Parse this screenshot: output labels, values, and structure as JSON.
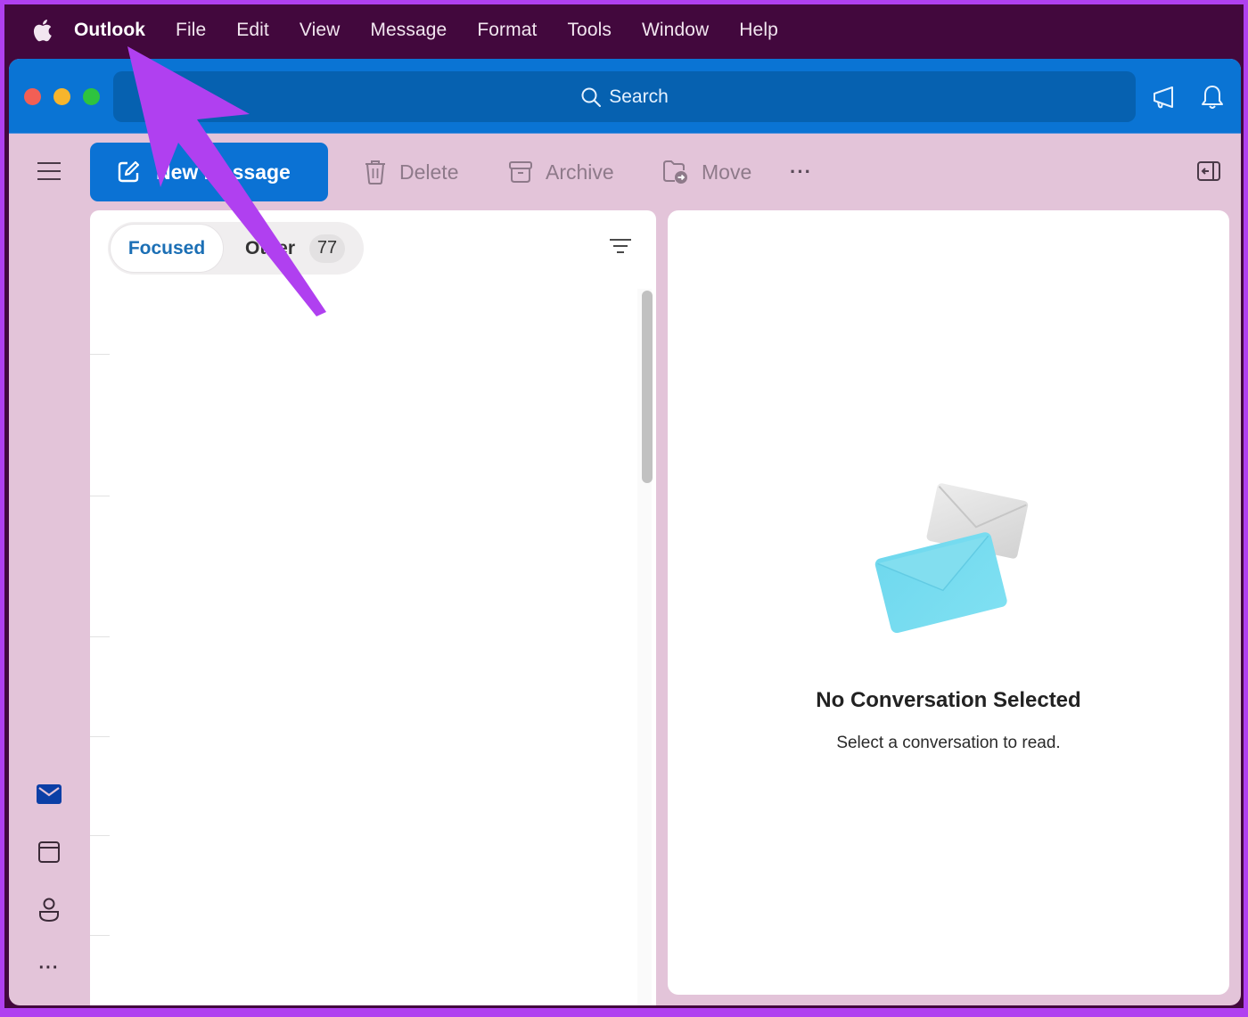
{
  "menubar": {
    "apple_icon": "apple-logo-icon",
    "items": [
      {
        "label": "Outlook",
        "active": true
      },
      {
        "label": "File"
      },
      {
        "label": "Edit"
      },
      {
        "label": "View"
      },
      {
        "label": "Message"
      },
      {
        "label": "Format"
      },
      {
        "label": "Tools"
      },
      {
        "label": "Window"
      },
      {
        "label": "Help"
      }
    ]
  },
  "titlebar": {
    "search_placeholder": "Search",
    "icons": [
      "megaphone-icon",
      "bell-icon"
    ]
  },
  "toolbar": {
    "new_message_label": "New Message",
    "delete_label": "Delete",
    "archive_label": "Archive",
    "move_label": "Move",
    "more_label": "···"
  },
  "message_list": {
    "tabs": [
      {
        "label": "Focused",
        "selected": true
      },
      {
        "label": "Other",
        "count": "77"
      }
    ]
  },
  "nav": {
    "items": [
      "mail-icon",
      "calendar-icon",
      "people-icon",
      "more-icon"
    ],
    "more_label": "···"
  },
  "reading_pane": {
    "title": "No Conversation Selected",
    "subtitle": "Select a conversation to read."
  },
  "colors": {
    "accent": "#0b72d4",
    "titlebar": "#0a74d4",
    "window_bg": "#e3c4d9",
    "menubar_bg": "#42083d",
    "annotation_arrow": "#b040f0"
  }
}
